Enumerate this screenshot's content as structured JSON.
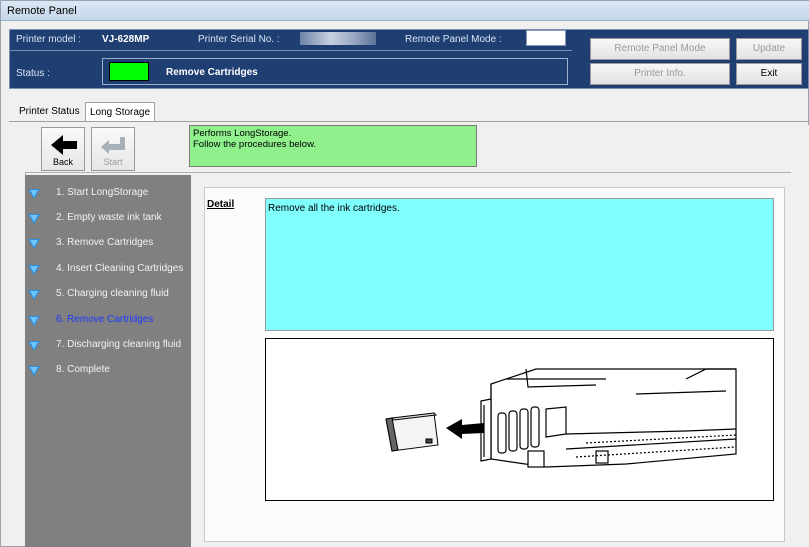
{
  "window": {
    "title": "Remote Panel"
  },
  "header": {
    "printer_model_label": "Printer model :",
    "printer_model_value": "VJ-628MP",
    "serial_label": "Printer Serial No. :",
    "remote_mode_label": "Remote Panel Mode :",
    "status_label": "Status :",
    "status_text": "Remove Cartridges",
    "status_color": "#00ff00",
    "buttons": {
      "remote_panel_mode": "Remote Panel Mode",
      "update": "Update",
      "printer_info": "Printer Info.",
      "exit": "Exit"
    }
  },
  "tabs": [
    {
      "label": "Printer Status"
    },
    {
      "label": "Long Storage"
    }
  ],
  "toolbar": {
    "back_label": "Back",
    "start_label": "Start",
    "info_line1": "Performs LongStorage.",
    "info_line2": "Follow the procedures below."
  },
  "steps": [
    {
      "label": "1. Start LongStorage"
    },
    {
      "label": "2. Empty waste ink tank"
    },
    {
      "label": "3. Remove Cartridges"
    },
    {
      "label": "4. Insert Cleaning Cartridges"
    },
    {
      "label": "5. Charging cleaning fluid"
    },
    {
      "label": "6. Remove Cartridges"
    },
    {
      "label": "7. Discharging cleaning fluid"
    },
    {
      "label": "8. Complete"
    }
  ],
  "detail": {
    "label": "Detail",
    "text": "Remove all the ink cartridges."
  }
}
